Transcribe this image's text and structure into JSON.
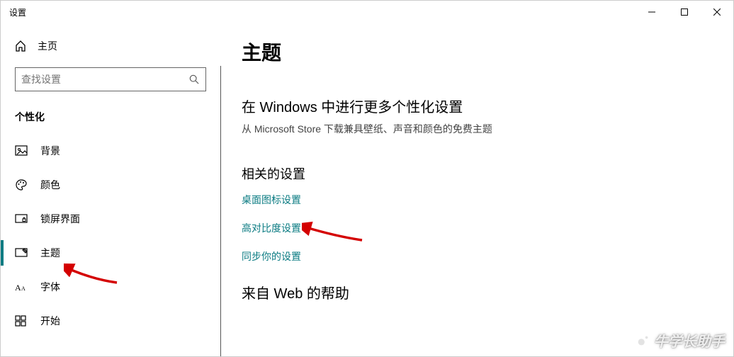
{
  "window": {
    "title": "设置"
  },
  "sidebar": {
    "home": "主页",
    "search_placeholder": "查找设置",
    "section": "个性化",
    "items": [
      {
        "label": "背景"
      },
      {
        "label": "颜色"
      },
      {
        "label": "锁屏界面"
      },
      {
        "label": "主题"
      },
      {
        "label": "字体"
      },
      {
        "label": "开始"
      }
    ]
  },
  "main": {
    "title": "主题",
    "more_heading": "在 Windows 中进行更多个性化设置",
    "more_desc": "从 Microsoft Store 下载兼具壁纸、声音和颜色的免费主题",
    "related_heading": "相关的设置",
    "links": [
      "桌面图标设置",
      "高对比度设置",
      "同步你的设置"
    ],
    "web_heading": "来自 Web 的帮助"
  },
  "watermark": "牛学长助手"
}
